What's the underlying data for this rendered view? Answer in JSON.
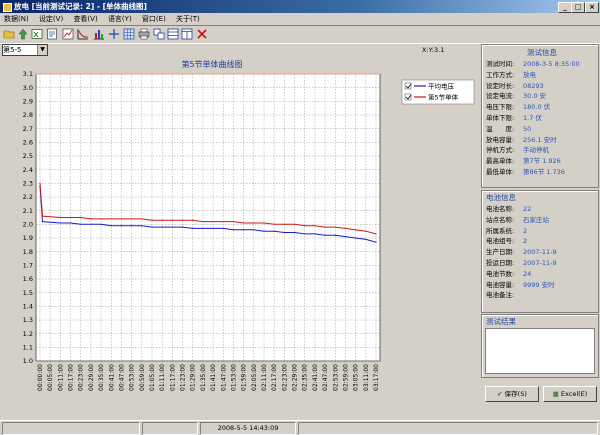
{
  "window": {
    "title": "放电 [当前测试记录: 2] - [单体曲线图]"
  },
  "menu": [
    "数据(N)",
    "设定(V)",
    "查看(V)",
    "语言(Y)",
    "窗口(E)",
    "关于(T)"
  ],
  "toolbar_icons": [
    "open-folder-icon",
    "upload-icon",
    "excel-icon",
    "report-icon",
    "chart-icon",
    "curve-icon",
    "bar-chart-icon",
    "compare-icon",
    "print-icon",
    "tile-icon",
    "split-h-icon",
    "split-v-icon",
    "close-icon"
  ],
  "selector": {
    "value": "第5-5"
  },
  "ratio_label": "X:Y:3.1",
  "chart_data": {
    "type": "line",
    "title": "第5节单体曲线图",
    "ylim": [
      1.0,
      3.1
    ],
    "yticks": [
      "3.1",
      "3.0",
      "2.9",
      "2.8",
      "2.7",
      "2.6",
      "2.5",
      "2.4",
      "2.3",
      "2.2",
      "2.1",
      "2.0",
      "1.9",
      "1.8",
      "1.7",
      "1.6",
      "1.5",
      "1.4",
      "1.3",
      "1.2",
      "1.1",
      "1.0"
    ],
    "xticks": [
      "00:00:00",
      "00:05:00",
      "00:11:00",
      "00:17:00",
      "00:23:00",
      "00:29:00",
      "00:35:00",
      "00:41:00",
      "00:47:00",
      "00:53:00",
      "00:59:00",
      "01:05:00",
      "01:11:00",
      "01:17:00",
      "01:23:00",
      "01:29:00",
      "01:35:00",
      "01:41:00",
      "01:47:00",
      "01:53:00",
      "01:59:00",
      "02:05:00",
      "02:11:00",
      "02:17:00",
      "02:23:00",
      "02:29:00",
      "02:35:00",
      "02:41:00",
      "02:47:00",
      "02:53:00",
      "02:59:00",
      "03:05:00",
      "03:11:00",
      "03:17:00"
    ],
    "series": [
      {
        "name": "平均电压",
        "color": "#1a1ad0",
        "values": [
          2.28,
          2.02,
          2.01,
          2.01,
          2.0,
          2.0,
          2.0,
          1.99,
          1.99,
          1.99,
          1.99,
          1.98,
          1.98,
          1.98,
          1.98,
          1.97,
          1.97,
          1.97,
          1.97,
          1.96,
          1.96,
          1.96,
          1.95,
          1.95,
          1.94,
          1.94,
          1.93,
          1.93,
          1.92,
          1.92,
          1.91,
          1.9,
          1.89,
          1.87
        ]
      },
      {
        "name": "第5节单体",
        "color": "#d01818",
        "values": [
          2.3,
          2.06,
          2.05,
          2.05,
          2.05,
          2.04,
          2.04,
          2.04,
          2.04,
          2.04,
          2.04,
          2.03,
          2.03,
          2.03,
          2.03,
          2.03,
          2.02,
          2.02,
          2.02,
          2.02,
          2.01,
          2.01,
          2.01,
          2.0,
          2.0,
          2.0,
          1.99,
          1.99,
          1.98,
          1.98,
          1.97,
          1.96,
          1.95,
          1.93
        ]
      }
    ],
    "ref_line": {
      "value": 3.1,
      "color": "#f0a080"
    },
    "grid": true,
    "legend": "top-right"
  },
  "test_info": {
    "title": "测试信息",
    "rows": [
      {
        "k": "测试时间:",
        "v": "2008-3-5 8:35:00"
      },
      {
        "k": "工作方式:",
        "v": "放电"
      },
      {
        "k": "设定时长:",
        "v": "08293"
      },
      {
        "k": "设定电流:",
        "v": "30.0 安"
      },
      {
        "k": "电压下限:",
        "v": "180.0 伏"
      },
      {
        "k": "单体下限:",
        "v": "1.7 伏"
      },
      {
        "k": "温　　度:",
        "v": "50"
      },
      {
        "k": "放电容量:",
        "v": "256.1 安时"
      },
      {
        "k": "停机方式:",
        "v": "手动停机"
      },
      {
        "k": "最高单体:",
        "v": "第7节 1.926"
      },
      {
        "k": "最低单体:",
        "v": "第86节 1.736"
      }
    ]
  },
  "battery_info": {
    "title": "电池信息",
    "rows": [
      {
        "k": "电池名称:",
        "v": "22"
      },
      {
        "k": "站点名称:",
        "v": "石家庄站"
      },
      {
        "k": "所属系统:",
        "v": "2"
      },
      {
        "k": "电池组号:",
        "v": "2"
      },
      {
        "k": "生产日期:",
        "v": "2007-11-9"
      },
      {
        "k": "投运日期:",
        "v": "2007-11-9"
      },
      {
        "k": "电池节数:",
        "v": "24"
      },
      {
        "k": "电池容量:",
        "v": "9999 安时"
      },
      {
        "k": "电池备注:",
        "v": ""
      }
    ]
  },
  "test_result": {
    "title": "测试结果"
  },
  "buttons": {
    "save": "保存(S)",
    "excel": "Excel(E)"
  },
  "status": {
    "datetime": "2008-5-5 14:43:09"
  },
  "colors": {
    "titlebar": "#0a246a",
    "info_value": "#2b55b5",
    "panel_title": "#244a9a"
  }
}
